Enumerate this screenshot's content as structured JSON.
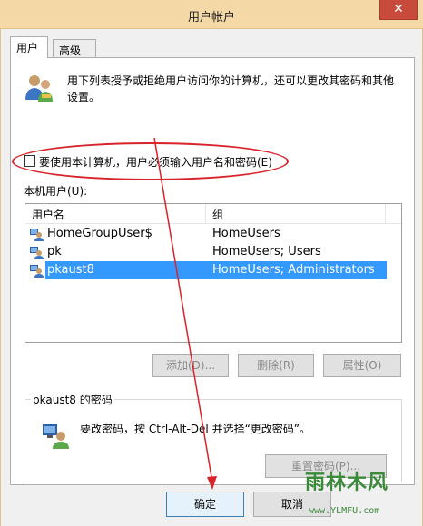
{
  "window": {
    "title": "用户帐户",
    "close_glyph": "✕"
  },
  "tabs": [
    {
      "label": "用户",
      "active": true
    },
    {
      "label": "高级",
      "active": false
    }
  ],
  "intro": {
    "text": "用下列表授予或拒绝用户访问你的计算机，还可以更改其密码和其他设置。"
  },
  "must_enter": {
    "label": "要使用本计算机，用户必须输入用户名和密码(E)",
    "checked": false
  },
  "local_users": {
    "label": "本机用户(U):",
    "columns": [
      "用户名",
      "组"
    ],
    "rows": [
      {
        "name": "HomeGroupUser$",
        "group": "HomeUsers",
        "selected": false
      },
      {
        "name": "pk",
        "group": "HomeUsers; Users",
        "selected": false
      },
      {
        "name": "pkaust8",
        "group": "HomeUsers; Administrators",
        "selected": true
      }
    ]
  },
  "buttons": {
    "add": "添加(D)...",
    "delete": "删除(R)",
    "properties": "属性(O)"
  },
  "password": {
    "title": "pkaust8 的密码",
    "text": "要改密码，按 Ctrl-Alt-Del 并选择“更改密码”。",
    "reset_button": "重置密码(P)..."
  },
  "footer": {
    "ok": "确定",
    "cancel": "取消"
  },
  "watermark": {
    "logo_text": "雨林木风",
    "url": "www.YLMFU.com"
  },
  "colors": {
    "titlebar": "#f4d8a5",
    "selection": "#3399ff",
    "annotation": "#d8232a",
    "close": "#c74a3b"
  },
  "icons": {
    "intro": "users-icon",
    "row": "user-icon",
    "password": "user-key-icon"
  }
}
